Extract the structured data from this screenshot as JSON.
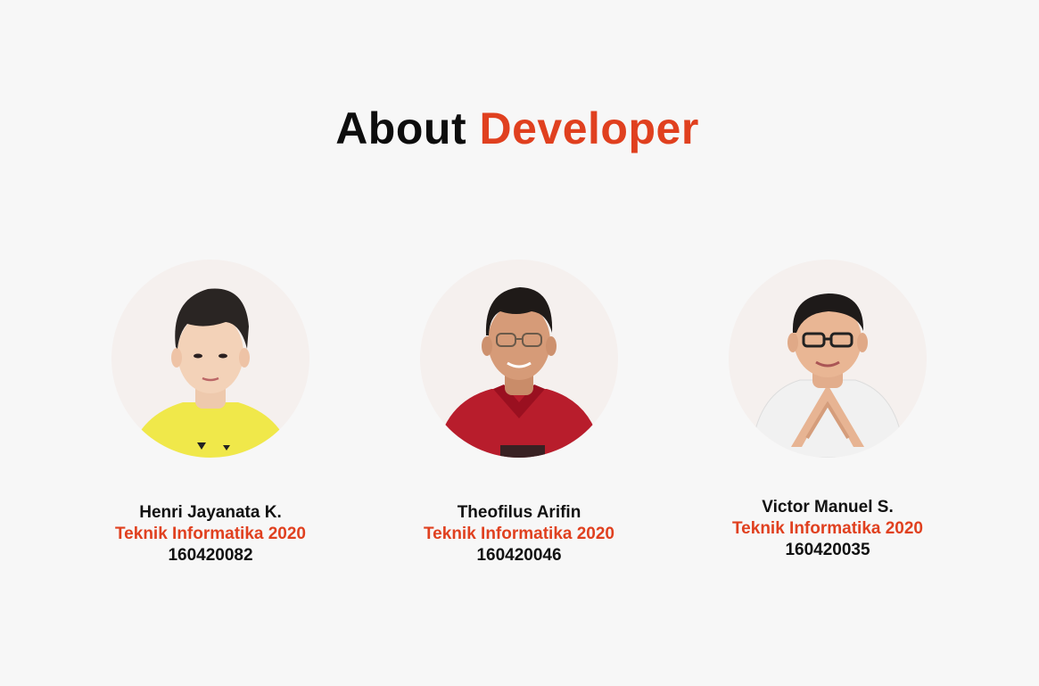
{
  "page": {
    "title_plain": "About",
    "title_accent": "Developer"
  },
  "theme": {
    "accent": "#e0401f",
    "text": "#111111",
    "background": "#f7f7f7",
    "avatar_bg": "#f5f0ee"
  },
  "developers": [
    {
      "name": "Henri Jayanata K.",
      "major": "Teknik Informatika 2020",
      "nim": "160420082",
      "photo_icon": "person-photo-yellow-shirt"
    },
    {
      "name": "Theofilus Arifin",
      "major": "Teknik Informatika 2020",
      "nim": "160420046",
      "photo_icon": "person-photo-red-shirt"
    },
    {
      "name": "Victor Manuel S.",
      "major": "Teknik Informatika 2020",
      "nim": "160420035",
      "photo_icon": "person-photo-white-shirt"
    }
  ]
}
